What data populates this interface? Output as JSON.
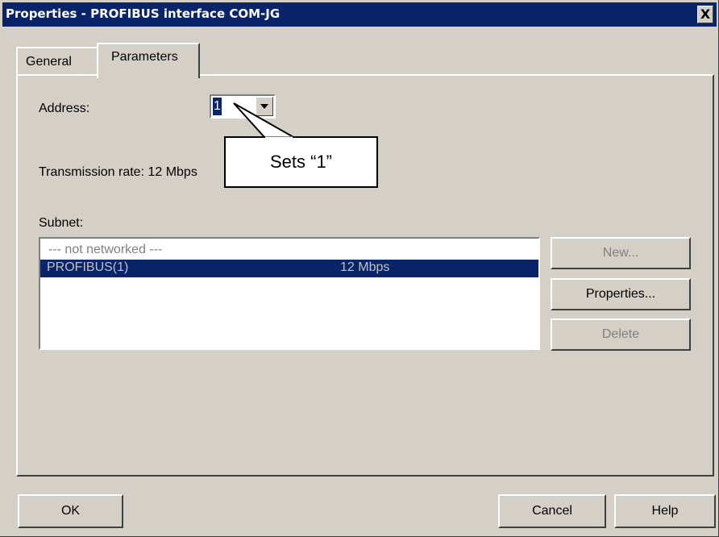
{
  "window": {
    "title": "Properties - PROFIBUS interface  COM-JG",
    "close_glyph": "X"
  },
  "tabs": [
    {
      "label": "General"
    },
    {
      "label": "Parameters",
      "selected": true
    }
  ],
  "parameters": {
    "address_label": "Address:",
    "address_value": "1",
    "transmission_rate": "Transmission rate: 12 Mbps",
    "subnet_label": "Subnet:",
    "subnets": [
      {
        "name": "--- not networked ---",
        "rate": ""
      },
      {
        "name": "PROFIBUS(1)",
        "rate": "12 Mbps",
        "selected": true
      }
    ]
  },
  "callout": {
    "text": "Sets “1”"
  },
  "side_buttons": {
    "new": "New...",
    "properties": "Properties...",
    "delete": "Delete"
  },
  "footer": {
    "ok": "OK",
    "cancel": "Cancel",
    "help": "Help"
  },
  "colors": {
    "title_bar": "#0a246a",
    "dialog_face": "#d4d0c8",
    "selection": "#0a246a",
    "disabled_text": "#808080"
  }
}
